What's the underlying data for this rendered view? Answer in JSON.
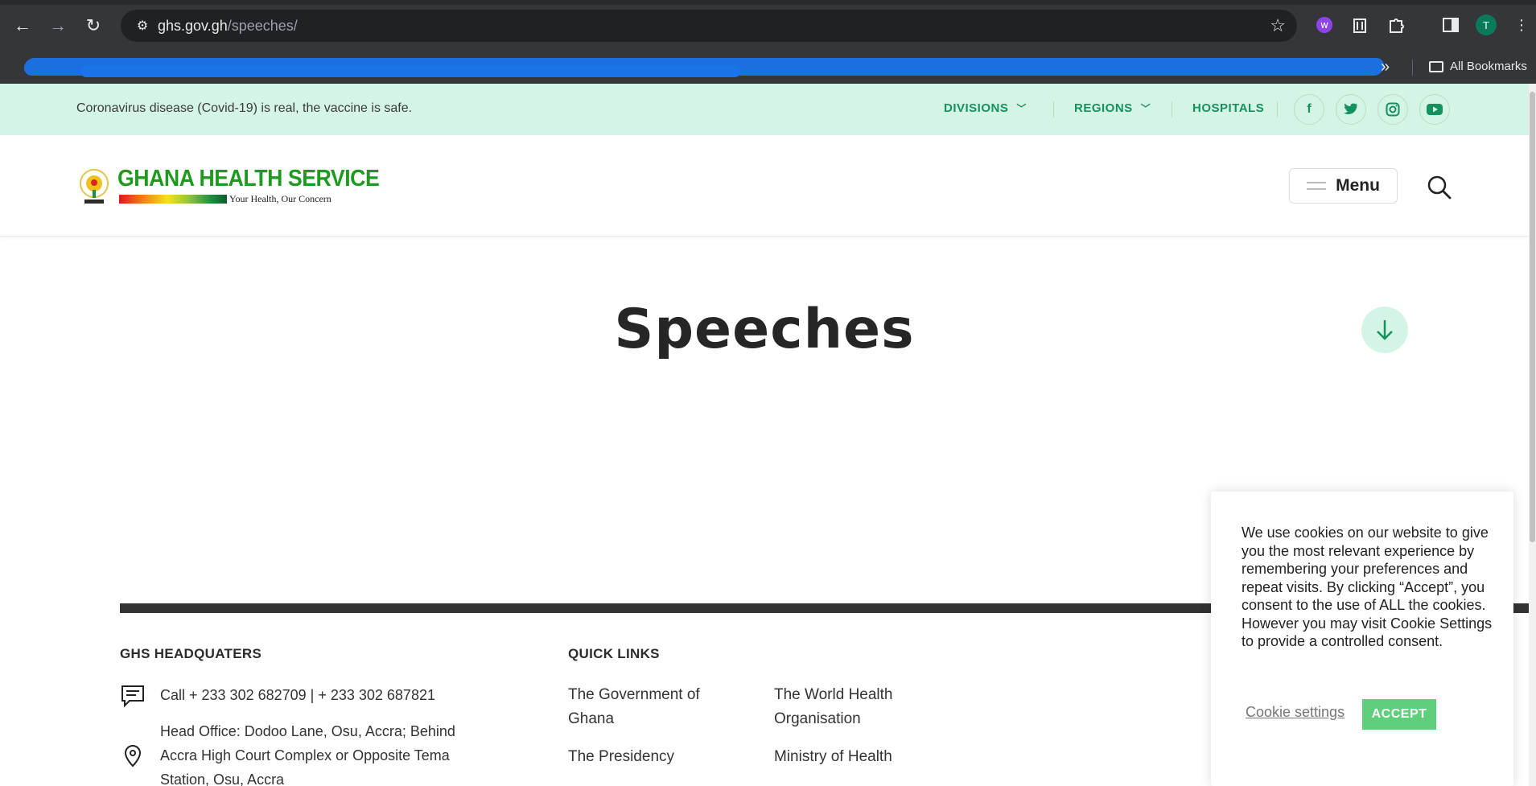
{
  "browser": {
    "url_host": "ghs.gov.gh",
    "url_path": "/speeches/",
    "bookmarks_all_label": "All Bookmarks",
    "profile_initial": "T",
    "more_glyph": "»"
  },
  "topbar": {
    "notice": "Coronavirus disease (Covid-19) is real, the vaccine is safe.",
    "nav": [
      {
        "label": "DIVISIONS"
      },
      {
        "label": "REGIONS"
      },
      {
        "label": "HOSPITALS"
      }
    ],
    "social": [
      {
        "name": "facebook-icon",
        "glyph": "f"
      },
      {
        "name": "twitter-icon",
        "glyph": "t"
      },
      {
        "name": "instagram-icon",
        "glyph": "◎"
      },
      {
        "name": "youtube-icon",
        "glyph": "▶"
      }
    ]
  },
  "header": {
    "logo_title": "GHANA HEALTH SERVICE",
    "logo_tagline": "Your Health, Our Concern",
    "menu_label": "Menu"
  },
  "main": {
    "title": "Speeches"
  },
  "footer": {
    "hq_heading": "GHS HEADQUATERS",
    "quick_links_heading": "QUICK LINKS",
    "contact": {
      "phone": "Call + 233 302 682709 | + 233 302 687821",
      "address_line1": "Head Office: Dodoo Lane, Osu, Accra; Behind",
      "address_line2": "Accra High Court Complex or Opposite Tema",
      "address_line3": "Station, Osu, Accra"
    },
    "quick_links": {
      "col1": [
        "The Government of",
        "Ghana",
        "The Presidency"
      ],
      "col2": [
        "The World Health",
        "Organisation",
        "Ministry of Health"
      ]
    }
  },
  "cookie": {
    "text": "We use cookies on our website to give you the most relevant experience by remembering your preferences and repeat visits. By clicking “Accept”, you consent to the use of ALL the cookies. However you may visit Cookie Settings to provide a controlled consent.",
    "settings_label": "Cookie settings",
    "accept_label": "ACCEPT"
  },
  "colors": {
    "accent": "#13915f",
    "topbar_bg": "#d4f5e6",
    "accept_bg": "#5fcf7d"
  }
}
